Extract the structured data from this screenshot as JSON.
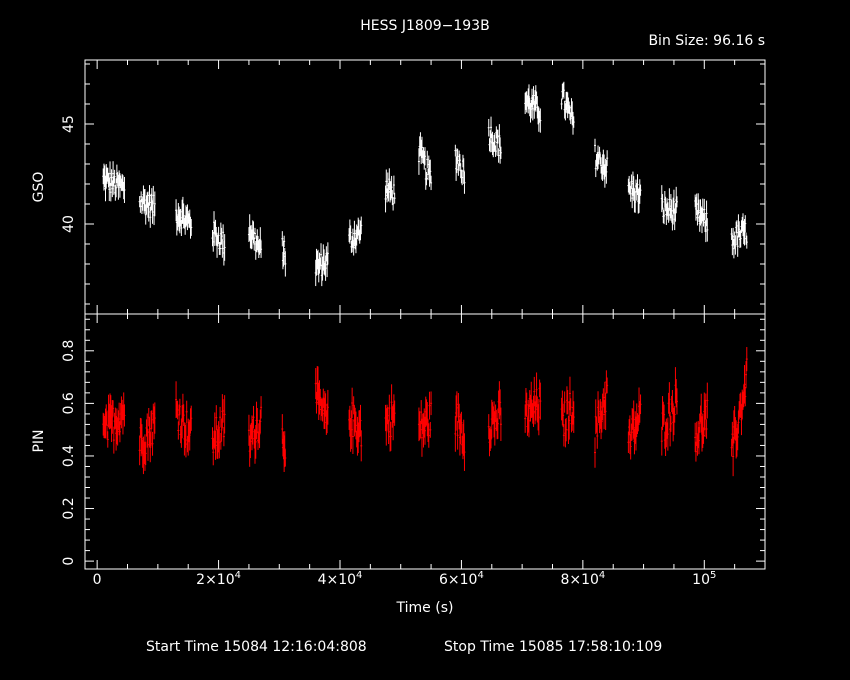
{
  "header": {
    "title": "HESS J1809−193B",
    "bin_size": "Bin Size: 96.16 s"
  },
  "footer": {
    "start_time": "Start Time 15084 12:16:04:808",
    "stop_time": "Stop Time 15085 17:58:10:109"
  },
  "colors": {
    "gso": "#ffffff",
    "pin": "#ff0000",
    "background": "#000000",
    "axes": "#ffffff"
  },
  "chart_data": [
    {
      "type": "scatter",
      "panel": "top",
      "ylabel": "GSO",
      "xlabel": "",
      "xlim": [
        -2000,
        110000
      ],
      "ylim": [
        35.5,
        48.2
      ],
      "yticks": [
        {
          "v": 40,
          "label": "40"
        },
        {
          "v": 45,
          "label": "45"
        }
      ],
      "series": [
        {
          "error_bars": true,
          "segments": [
            {
              "x0": 1000,
              "x1": 4500,
              "y0": 42.2,
              "y1": 41.8
            },
            {
              "x0": 7000,
              "x1": 9500,
              "y0": 41.2,
              "y1": 40.8
            },
            {
              "x0": 13000,
              "x1": 15500,
              "y0": 40.6,
              "y1": 40.0
            },
            {
              "x0": 19000,
              "x1": 21000,
              "y0": 39.6,
              "y1": 39.0
            },
            {
              "x0": 25000,
              "x1": 27000,
              "y0": 39.8,
              "y1": 38.6
            },
            {
              "x0": 30500,
              "x1": 31000,
              "y0": 38.8,
              "y1": 38.4
            },
            {
              "x0": 36000,
              "x1": 38000,
              "y0": 37.8,
              "y1": 38.2
            },
            {
              "x0": 41500,
              "x1": 43500,
              "y0": 39.2,
              "y1": 39.6
            },
            {
              "x0": 47500,
              "x1": 49000,
              "y0": 41.8,
              "y1": 41.5
            },
            {
              "x0": 53000,
              "x1": 55000,
              "y0": 43.6,
              "y1": 42.2
            },
            {
              "x0": 59000,
              "x1": 60500,
              "y0": 43.4,
              "y1": 42.6
            },
            {
              "x0": 64500,
              "x1": 66500,
              "y0": 44.6,
              "y1": 43.8
            },
            {
              "x0": 70500,
              "x1": 73000,
              "y0": 46.2,
              "y1": 45.6
            },
            {
              "x0": 76500,
              "x1": 78500,
              "y0": 46.4,
              "y1": 45.0
            },
            {
              "x0": 82000,
              "x1": 84000,
              "y0": 43.4,
              "y1": 42.8
            },
            {
              "x0": 87500,
              "x1": 89500,
              "y0": 41.8,
              "y1": 41.4
            },
            {
              "x0": 93000,
              "x1": 95500,
              "y0": 40.8,
              "y1": 40.6
            },
            {
              "x0": 98500,
              "x1": 100500,
              "y0": 40.6,
              "y1": 40.0
            },
            {
              "x0": 104500,
              "x1": 107000,
              "y0": 39.2,
              "y1": 39.6
            }
          ]
        }
      ]
    },
    {
      "type": "scatter",
      "panel": "bottom",
      "ylabel": "PIN",
      "xlabel": "Time (s)",
      "xlim": [
        -2000,
        110000
      ],
      "ylim": [
        -0.03,
        0.94
      ],
      "yticks": [
        {
          "v": 0,
          "label": "0"
        },
        {
          "v": 0.2,
          "label": "0.2"
        },
        {
          "v": 0.4,
          "label": "0.4"
        },
        {
          "v": 0.6,
          "label": "0.6"
        },
        {
          "v": 0.8,
          "label": "0.8"
        }
      ],
      "xticks": [
        {
          "v": 0,
          "base": "0",
          "exp": ""
        },
        {
          "v": 20000,
          "base": "2×10",
          "exp": "4"
        },
        {
          "v": 40000,
          "base": "4×10",
          "exp": "4"
        },
        {
          "v": 60000,
          "base": "6×10",
          "exp": "4"
        },
        {
          "v": 80000,
          "base": "8×10",
          "exp": "4"
        },
        {
          "v": 100000,
          "base": "10",
          "exp": "5"
        }
      ],
      "series": [
        {
          "error_bars": true,
          "segments": [
            {
              "x0": 1000,
              "x1": 4500,
              "y0": 0.48,
              "y1": 0.58
            },
            {
              "x0": 7000,
              "x1": 9500,
              "y0": 0.45,
              "y1": 0.52
            },
            {
              "x0": 13000,
              "x1": 15500,
              "y0": 0.58,
              "y1": 0.48
            },
            {
              "x0": 19000,
              "x1": 21000,
              "y0": 0.46,
              "y1": 0.52
            },
            {
              "x0": 25000,
              "x1": 27000,
              "y0": 0.45,
              "y1": 0.55
            },
            {
              "x0": 30500,
              "x1": 31000,
              "y0": 0.48,
              "y1": 0.46
            },
            {
              "x0": 36000,
              "x1": 38000,
              "y0": 0.62,
              "y1": 0.52
            },
            {
              "x0": 41500,
              "x1": 43500,
              "y0": 0.55,
              "y1": 0.5
            },
            {
              "x0": 47500,
              "x1": 49000,
              "y0": 0.52,
              "y1": 0.56
            },
            {
              "x0": 53000,
              "x1": 55000,
              "y0": 0.5,
              "y1": 0.54
            },
            {
              "x0": 59000,
              "x1": 60500,
              "y0": 0.55,
              "y1": 0.48
            },
            {
              "x0": 64500,
              "x1": 66500,
              "y0": 0.52,
              "y1": 0.55
            },
            {
              "x0": 70500,
              "x1": 73000,
              "y0": 0.55,
              "y1": 0.6
            },
            {
              "x0": 76500,
              "x1": 78500,
              "y0": 0.52,
              "y1": 0.6
            },
            {
              "x0": 82000,
              "x1": 84000,
              "y0": 0.48,
              "y1": 0.65
            },
            {
              "x0": 87500,
              "x1": 89500,
              "y0": 0.45,
              "y1": 0.55
            },
            {
              "x0": 93000,
              "x1": 95500,
              "y0": 0.5,
              "y1": 0.62
            },
            {
              "x0": 98500,
              "x1": 100500,
              "y0": 0.48,
              "y1": 0.55
            },
            {
              "x0": 104500,
              "x1": 107000,
              "y0": 0.4,
              "y1": 0.7
            }
          ]
        }
      ]
    }
  ]
}
